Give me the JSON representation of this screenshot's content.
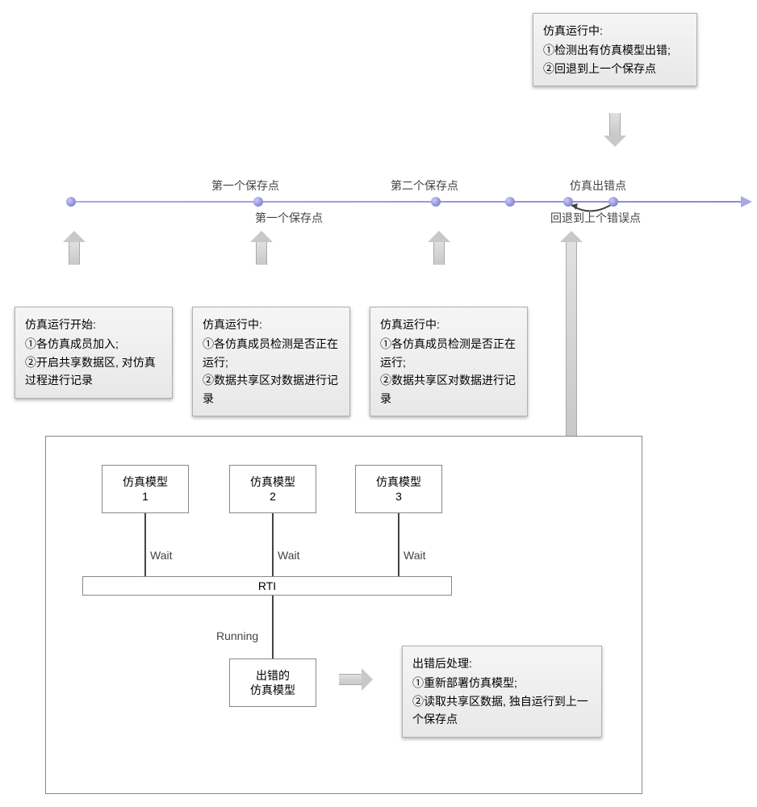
{
  "timeline": {
    "labels": {
      "savepoint1_top": "第一个保存点",
      "savepoint1_bottom": "第一个保存点",
      "savepoint2": "第二个保存点",
      "error_point": "仿真出错点",
      "rollback": "回退到上个错误点"
    }
  },
  "boxes": {
    "error_detect": {
      "title": "仿真运行中:",
      "line1": "①检测出有仿真模型出错;",
      "line2": "②回退到上一个保存点"
    },
    "start": {
      "title": "仿真运行开始:",
      "line1": "①各仿真成员加入;",
      "line2": "②开启共享数据区, 对仿真过程进行记录"
    },
    "checkpoint1": {
      "title": "仿真运行中:",
      "line1": "①各仿真成员检测是否正在运行;",
      "line2": "②数据共享区对数据进行记录"
    },
    "checkpoint2": {
      "title": "仿真运行中:",
      "line1": "①各仿真成员检测是否正在运行;",
      "line2": "②数据共享区对数据进行记录"
    },
    "post_error": {
      "title": "出错后处理:",
      "line1": "①重新部署仿真模型;",
      "line2": "②读取共享区数据, 独自运行到上一个保存点"
    }
  },
  "models": {
    "m1": {
      "name": "仿真模型",
      "num": "1"
    },
    "m2": {
      "name": "仿真模型",
      "num": "2"
    },
    "m3": {
      "name": "仿真模型",
      "num": "3"
    },
    "err": {
      "line1": "出错的",
      "line2": "仿真模型"
    }
  },
  "edges": {
    "wait": "Wait",
    "rti": "RTI",
    "running": "Running"
  }
}
